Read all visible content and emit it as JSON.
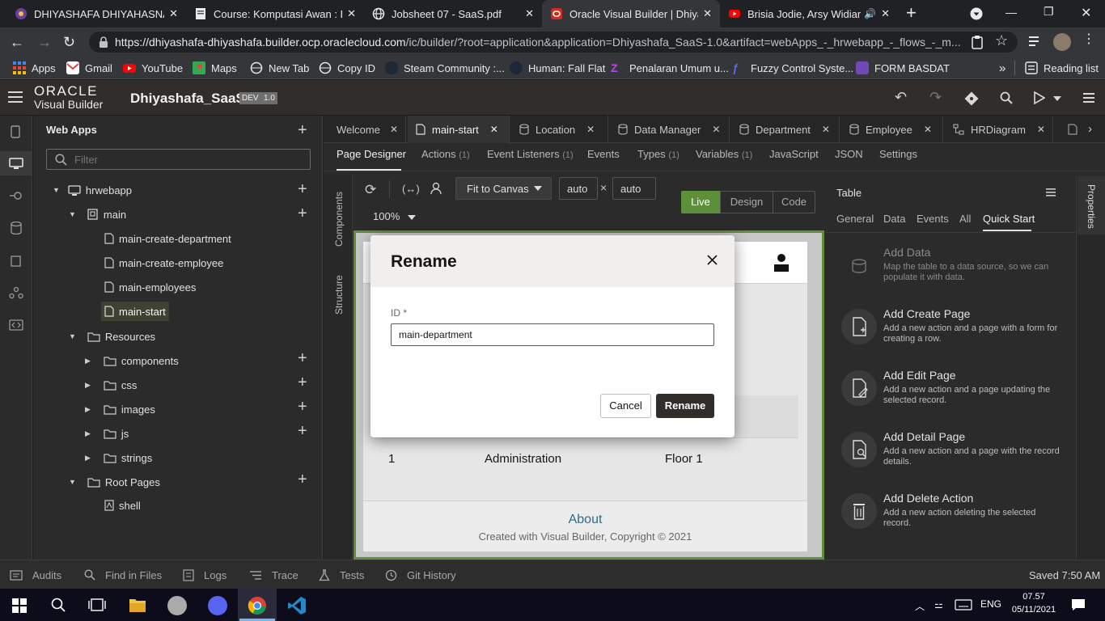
{
  "browser": {
    "tabs": [
      {
        "title": "DHIYASHAFA DHIYAHASNA H",
        "active": false
      },
      {
        "title": "Course: Komputasi Awan : Dip",
        "active": false
      },
      {
        "title": "Jobsheet 07 - SaaS.pdf",
        "active": false
      },
      {
        "title": "Oracle Visual Builder | Dhiyas",
        "active": true
      },
      {
        "title": "Brisia Jodie, Arsy Widiant",
        "active": false
      }
    ],
    "url_host": "https://dhiyashafa-dhiyashafa.builder.ocp.oraclecloud.com",
    "url_path": "/ic/builder/?root=application&application=Dhiyashafa_SaaS-1.0&artifact=webApps_-_hrwebapp_-_flows_-_m...",
    "bookmarks": [
      "Apps",
      "Gmail",
      "YouTube",
      "Maps",
      "New Tab",
      "Copy ID",
      "Steam Community :...",
      "Human: Fall Flat",
      "Penalaran Umum u...",
      "Fuzzy Control Syste...",
      "FORM BASDAT"
    ],
    "reading_list": "Reading list",
    "overflow": "»"
  },
  "vb": {
    "brand_top": "ORACLE",
    "brand_bottom": "Visual Builder",
    "app_name": "Dhiyashafa_SaaS",
    "badge_dev": "DEV",
    "badge_ver": "1.0"
  },
  "navigator": {
    "title": "Web Apps",
    "filter_placeholder": "Filter",
    "items": [
      {
        "label": "hrwebapp"
      },
      {
        "label": "main"
      },
      {
        "label": "main-create-department"
      },
      {
        "label": "main-create-employee"
      },
      {
        "label": "main-employees"
      },
      {
        "label": "main-start"
      },
      {
        "label": "Resources"
      },
      {
        "label": "components"
      },
      {
        "label": "css"
      },
      {
        "label": "images"
      },
      {
        "label": "js"
      },
      {
        "label": "strings"
      },
      {
        "label": "Root Pages"
      },
      {
        "label": "shell"
      }
    ]
  },
  "editor": {
    "tabs": [
      "Welcome",
      "main-start",
      "Location",
      "Data Manager",
      "Department",
      "Employee",
      "HRDiagram"
    ],
    "subtabs": [
      {
        "label": "Page Designer",
        "count": ""
      },
      {
        "label": "Actions",
        "count": "(1)"
      },
      {
        "label": "Event Listeners",
        "count": "(1)"
      },
      {
        "label": "Events",
        "count": ""
      },
      {
        "label": "Types",
        "count": "(1)"
      },
      {
        "label": "Variables",
        "count": "(1)"
      },
      {
        "label": "JavaScript",
        "count": ""
      },
      {
        "label": "JSON",
        "count": ""
      },
      {
        "label": "Settings",
        "count": ""
      }
    ],
    "side_components": "Components",
    "side_structure": "Structure",
    "fit": "Fit to Canvas",
    "width": "auto",
    "times": "×",
    "height": "auto",
    "zoom": "100%",
    "modes": [
      "Live",
      "Design",
      "Code"
    ]
  },
  "canvas": {
    "row_id": "1",
    "row_name": "Administration",
    "row_loc": "Floor 1",
    "footer_link": "About",
    "footer_text": "Created with Visual Builder, Copyright © 2021"
  },
  "properties": {
    "section": "Table",
    "vertical_tab": "Properties",
    "tabs": [
      "General",
      "Data",
      "Events",
      "All",
      "Quick Start"
    ],
    "quick_start": [
      {
        "title": "Add Data",
        "desc": "Map the table to a data source, so we can populate it with data."
      },
      {
        "title": "Add Create Page",
        "desc": "Add a new action and a page with a form for creating a row."
      },
      {
        "title": "Add Edit Page",
        "desc": "Add a new action and a page updating the selected record."
      },
      {
        "title": "Add Detail Page",
        "desc": "Add a new action and a page with the record details."
      },
      {
        "title": "Add Delete Action",
        "desc": "Add a new action deleting the selected record."
      }
    ]
  },
  "dialog": {
    "title": "Rename",
    "field_label": "ID",
    "required_mark": "*",
    "field_value": "main-department",
    "cancel": "Cancel",
    "confirm": "Rename"
  },
  "statusbar": {
    "items": [
      "Audits",
      "Find in Files",
      "Logs",
      "Trace",
      "Tests",
      "Git History"
    ],
    "saved": "Saved 7:50 AM"
  },
  "taskbar": {
    "time": "07.57",
    "date": "05/11/2021",
    "lang": "ENG"
  },
  "colors": {
    "live_green": "#5e8f3a",
    "header_bg": "#312d2a",
    "primary_button": "#312d2a"
  }
}
